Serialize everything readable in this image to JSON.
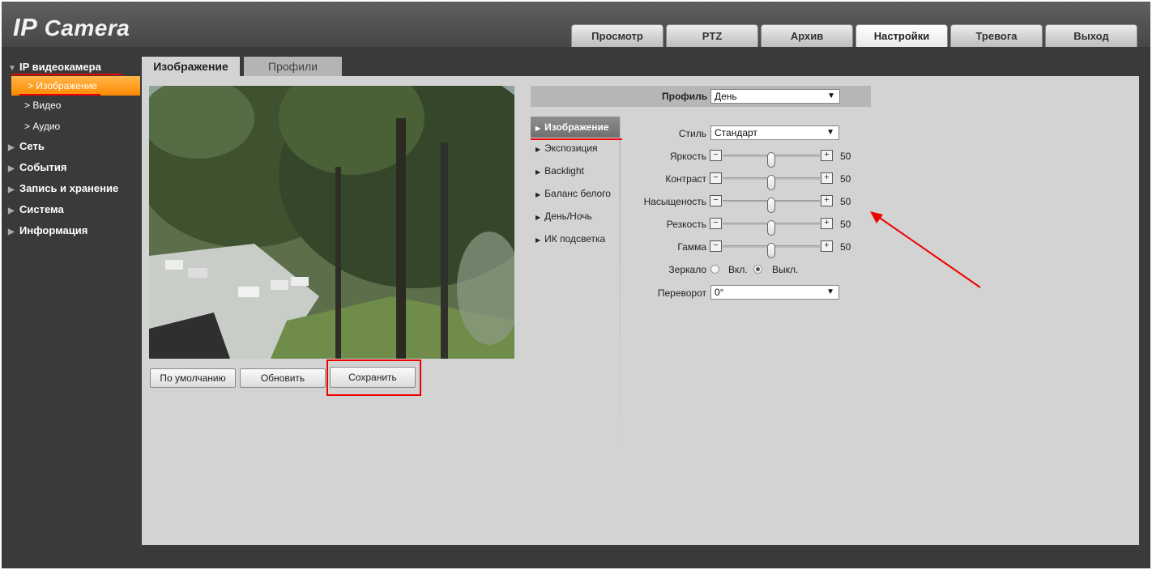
{
  "header": {
    "logo_ip": "IP",
    "logo_camera": " Camera",
    "tabs": [
      {
        "label": "Просмотр"
      },
      {
        "label": "PTZ"
      },
      {
        "label": "Архив"
      },
      {
        "label": "Настройки",
        "active": true
      },
      {
        "label": "Тревога"
      },
      {
        "label": "Выход"
      }
    ]
  },
  "sidebar": {
    "root": "IP видеокамера",
    "sub_items": [
      {
        "label": "Изображение",
        "active": true
      },
      {
        "label": "Видео"
      },
      {
        "label": "Аудио"
      }
    ],
    "items": [
      {
        "label": "Сеть"
      },
      {
        "label": "События"
      },
      {
        "label": "Запись и хранение"
      },
      {
        "label": "Система"
      },
      {
        "label": "Информация"
      }
    ]
  },
  "subtabs": [
    {
      "label": "Изображение",
      "active": true
    },
    {
      "label": "Профили"
    }
  ],
  "preview_buttons": {
    "default": "По умолчанию",
    "refresh": "Обновить",
    "save": "Сохранить"
  },
  "profile": {
    "label": "Профиль",
    "value": "День"
  },
  "settings_menu": [
    {
      "label": "Изображение",
      "active": true
    },
    {
      "label": "Экспозиция"
    },
    {
      "label": "Backlight"
    },
    {
      "label": "Баланс белого"
    },
    {
      "label": "День/Ночь"
    },
    {
      "label": "ИК подсветка"
    }
  ],
  "image_settings": {
    "style_label": "Стиль",
    "style_value": "Стандарт",
    "sliders": [
      {
        "label": "Яркость",
        "value": "50"
      },
      {
        "label": "Контраст",
        "value": "50"
      },
      {
        "label": "Насыщеность",
        "value": "50"
      },
      {
        "label": "Резкость",
        "value": "50"
      },
      {
        "label": "Гамма",
        "value": "50"
      }
    ],
    "slider_level_percent": 50,
    "mirror_label": "Зеркало",
    "mirror_on": "Вкл.",
    "mirror_off": "Выкл.",
    "mirror_selected": "Выкл.",
    "flip_label": "Переворот",
    "flip_value": "0°"
  },
  "colors": {
    "accent_orange": "#ff8a00",
    "annotation_red": "#e00000",
    "panel_bg": "#d3d3d3",
    "frame_bg": "#3a3a3a"
  },
  "icons": {
    "collapse": "triangle-down-icon",
    "expand": "triangle-right-icon",
    "submenu": "chevron-right-icon",
    "dropdown": "caret-down-icon"
  }
}
